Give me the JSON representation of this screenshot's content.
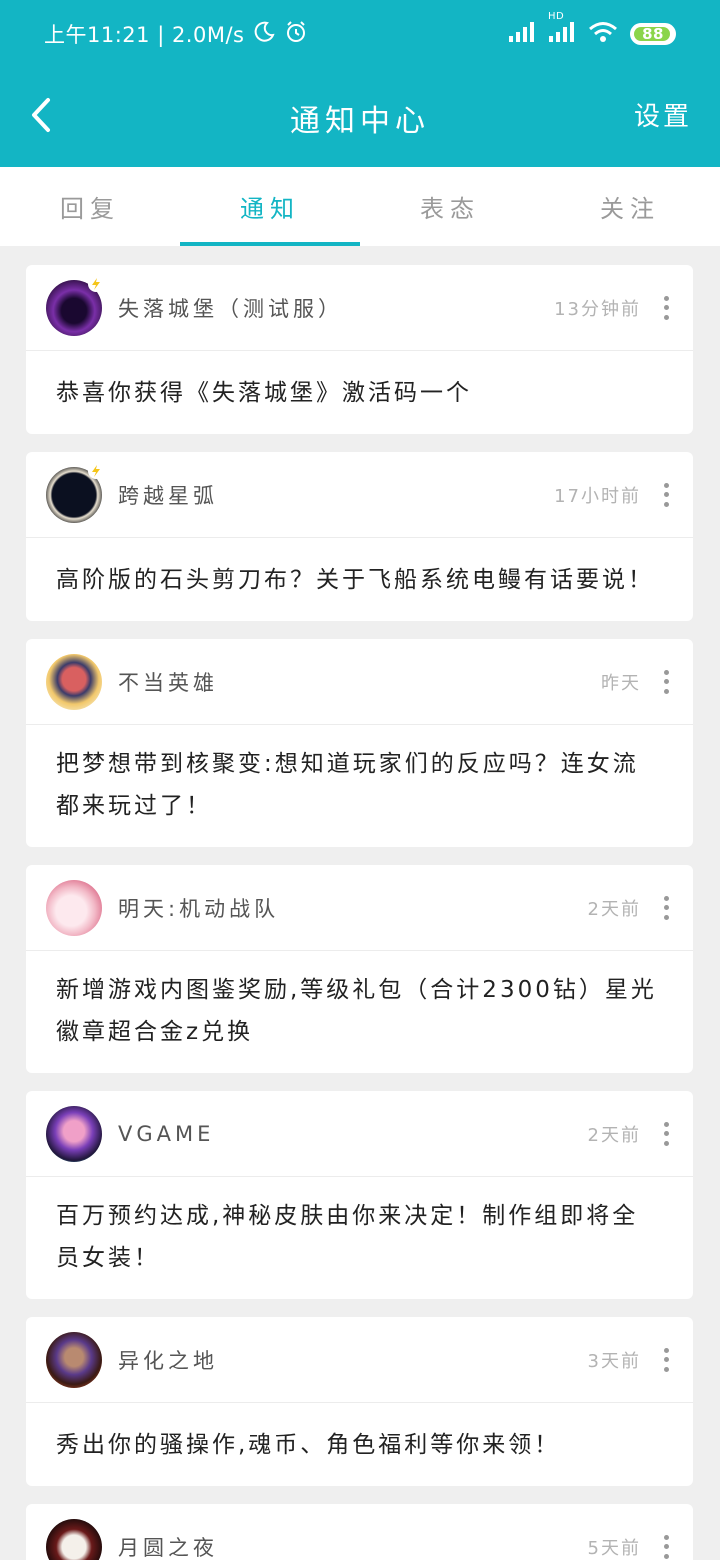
{
  "status_bar": {
    "time_speed": "上午11:21 | 2.0M/s",
    "battery": "88",
    "hd_label": "HD"
  },
  "header": {
    "title": "通知中心",
    "settings_label": "设置"
  },
  "tabs": [
    {
      "label": "回复"
    },
    {
      "label": "通知"
    },
    {
      "label": "表态"
    },
    {
      "label": "关注"
    }
  ],
  "notifications": [
    {
      "game": "失落城堡（测试服）",
      "time": "13分钟前",
      "message": "恭喜你获得《失落城堡》激活码一个"
    },
    {
      "game": "跨越星弧",
      "time": "17小时前",
      "message": "高阶版的石头剪刀布？关于飞船系统电鳗有话要说！"
    },
    {
      "game": "不当英雄",
      "time": "昨天",
      "message": "把梦想带到核聚变:想知道玩家们的反应吗？连女流都来玩过了！"
    },
    {
      "game": "明天:机动战队",
      "time": "2天前",
      "message": "新增游戏内图鉴奖励,等级礼包（合计2300钻）星光徽章超合金z兑换"
    },
    {
      "game": "VGAME",
      "time": "2天前",
      "message": "百万预约达成,神秘皮肤由你来决定！制作组即将全员女装！"
    },
    {
      "game": "异化之地",
      "time": "3天前",
      "message": "秀出你的骚操作,魂币、角色福利等你来领！"
    },
    {
      "game": "月圆之夜",
      "time": "5天前",
      "message": ""
    }
  ],
  "colors": {
    "accent": "#13b5c4",
    "background": "#efefef"
  }
}
